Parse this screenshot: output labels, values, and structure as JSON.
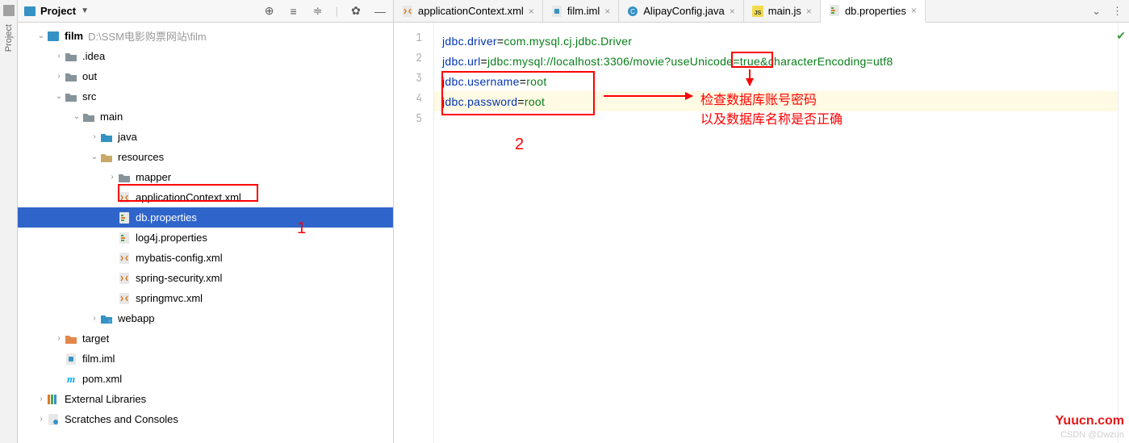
{
  "left_rail": {
    "label": "Project"
  },
  "project": {
    "title": "Project",
    "root_label": "film",
    "root_path": "D:\\SSM电影购票网站\\film"
  },
  "tree": [
    {
      "indent": 1,
      "arrow": ">",
      "label": ".idea",
      "icon": "folder"
    },
    {
      "indent": 1,
      "arrow": ">",
      "label": "out",
      "icon": "folder"
    },
    {
      "indent": 1,
      "arrow": "v",
      "label": "src",
      "icon": "folder"
    },
    {
      "indent": 2,
      "arrow": "v",
      "label": "main",
      "icon": "folder"
    },
    {
      "indent": 3,
      "arrow": ">",
      "label": "java",
      "icon": "folder-blue"
    },
    {
      "indent": 3,
      "arrow": "v",
      "label": "resources",
      "icon": "folder-gold"
    },
    {
      "indent": 4,
      "arrow": ">",
      "label": "mapper",
      "icon": "folder"
    },
    {
      "indent": 4,
      "arrow": "",
      "label": "applicationContext.xml",
      "icon": "xml"
    },
    {
      "indent": 4,
      "arrow": "",
      "label": "db.properties",
      "icon": "prop",
      "selected": true
    },
    {
      "indent": 4,
      "arrow": "",
      "label": "log4j.properties",
      "icon": "prop"
    },
    {
      "indent": 4,
      "arrow": "",
      "label": "mybatis-config.xml",
      "icon": "xml"
    },
    {
      "indent": 4,
      "arrow": "",
      "label": "spring-security.xml",
      "icon": "xml"
    },
    {
      "indent": 4,
      "arrow": "",
      "label": "springmvc.xml",
      "icon": "xml"
    },
    {
      "indent": 3,
      "arrow": ">",
      "label": "webapp",
      "icon": "folder-blue-dot"
    },
    {
      "indent": 1,
      "arrow": ">",
      "label": "target",
      "icon": "folder-orange"
    },
    {
      "indent": 1,
      "arrow": "",
      "label": "film.iml",
      "icon": "iml"
    },
    {
      "indent": 1,
      "arrow": "",
      "label": "pom.xml",
      "icon": "maven"
    }
  ],
  "tree_extra": [
    {
      "indent": 0,
      "arrow": ">",
      "label": "External Libraries",
      "icon": "lib"
    },
    {
      "indent": 0,
      "arrow": ">",
      "label": "Scratches and Consoles",
      "icon": "scratch"
    }
  ],
  "tabs": [
    {
      "label": "applicationContext.xml",
      "icon": "xml"
    },
    {
      "label": "film.iml",
      "icon": "iml"
    },
    {
      "label": "AlipayConfig.java",
      "icon": "java"
    },
    {
      "label": "main.js",
      "icon": "js"
    },
    {
      "label": "db.properties",
      "icon": "prop",
      "active": true
    }
  ],
  "code": [
    {
      "key": "jdbc.driver",
      "val": "com.mysql.cj.jdbc.Driver"
    },
    {
      "key": "jdbc.url",
      "val": "jdbc:mysql://localhost:3306/movie?useUnicode=true&characterEncoding=utf8"
    },
    {
      "key": "jdbc.username",
      "val": "root"
    },
    {
      "key": "jdbc.password",
      "val": "root"
    }
  ],
  "gutter_lines": [
    "1",
    "2",
    "3",
    "4",
    "5"
  ],
  "anno": {
    "num1": "1",
    "num2": "2",
    "text1": "检查数据库账号密码",
    "text2": "以及数据库名称是否正确"
  },
  "watermark": {
    "brand": "Yuucn.com",
    "csdn": "CSDN @Dwzun"
  }
}
